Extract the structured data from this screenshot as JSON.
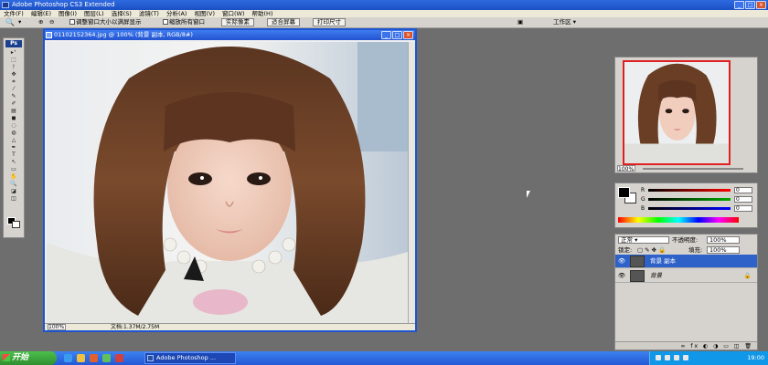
{
  "app": {
    "title": "Adobe Photoshop CS3 Extended",
    "window_controls": {
      "min": "_",
      "max": "□",
      "close": "×"
    }
  },
  "menu": [
    "文件(F)",
    "编辑(E)",
    "图像(I)",
    "图层(L)",
    "选择(S)",
    "滤镜(T)",
    "分析(A)",
    "视图(V)",
    "窗口(W)",
    "帮助(H)"
  ],
  "options_bar": {
    "tool_icon": "zoom-icon",
    "resize_window_label": "调整窗口大小以满屏显示",
    "zoom_all_label": "缩放所有窗口",
    "actual_pixels": "实际像素",
    "fit_screen": "适合屏幕",
    "print_size": "打印尺寸",
    "workspace": "工作区 ▾"
  },
  "toolbox": {
    "logo": "Ps",
    "tools": [
      "▸⁺",
      "⬚",
      "ᚹ",
      "✥",
      "⌗",
      "⁄",
      "✎",
      "✐",
      "▤",
      "◼",
      "◌",
      "◍",
      "△",
      "✒",
      "T",
      "↖",
      "▭",
      "✋",
      "🔍",
      "◪",
      "◫"
    ]
  },
  "document": {
    "title": "01102152364.jpg @ 100% (背景 副本, RGB/8#)",
    "zoom": "100%",
    "file_info": "文档:1.37M/2.75M"
  },
  "navigator": {
    "zoom": "100%"
  },
  "color_panel": {
    "channels": [
      {
        "label": "R",
        "value": "0",
        "color": "#d02020"
      },
      {
        "label": "G",
        "value": "0",
        "color": "#20a020"
      },
      {
        "label": "B",
        "value": "0",
        "color": "#2040d0"
      }
    ]
  },
  "layers_panel": {
    "blend_mode": "正常",
    "opacity_label": "不透明度:",
    "opacity_value": "100%",
    "lock_label": "锁定:",
    "fill_label": "填充:",
    "fill_value": "100%",
    "layers": [
      {
        "name": "背景 副本",
        "active": true,
        "locked": false
      },
      {
        "name": "背景",
        "active": false,
        "locked": true
      }
    ],
    "bottom_icons": "∞ fx ◐ ◑ ▭ ◫ 🗑"
  },
  "taskbar": {
    "start": "开始",
    "task_label": "Adobe Photoshop ...",
    "clock": "19:00"
  }
}
